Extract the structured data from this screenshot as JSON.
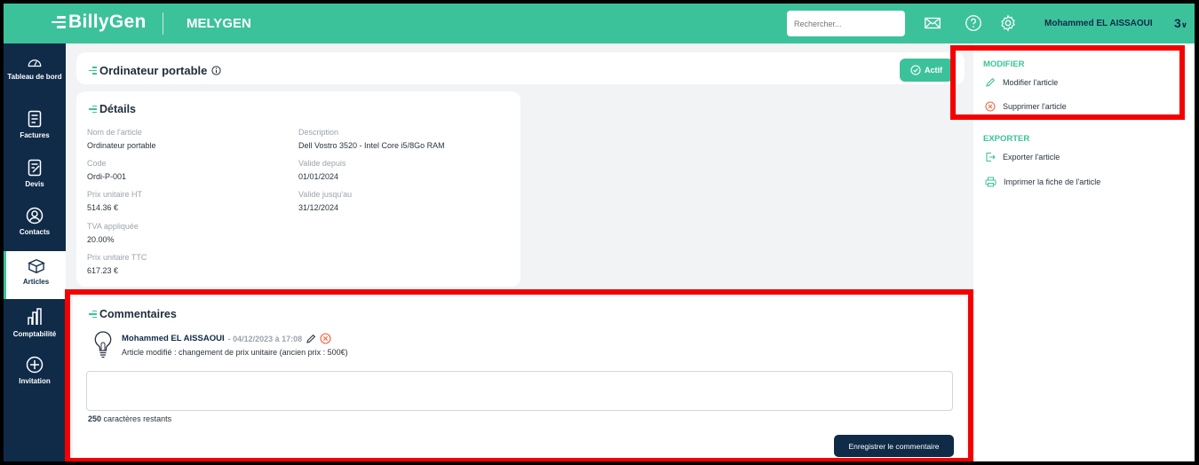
{
  "app": {
    "brand": "BillyGen",
    "company": "MELYGEN"
  },
  "topbar": {
    "search_placeholder": "Rechercher...",
    "user_name": "Mohammed EL AISSAOUI",
    "user_menu": "3"
  },
  "sidebar": {
    "items": [
      {
        "label": "Tableau de bord",
        "icon": "gauge-icon"
      },
      {
        "label": "Factures",
        "icon": "invoice-icon"
      },
      {
        "label": "Devis",
        "icon": "quote-icon"
      },
      {
        "label": "Contacts",
        "icon": "contacts-icon"
      },
      {
        "label": "Articles",
        "icon": "box-icon",
        "active": true
      },
      {
        "label": "Comptabilité",
        "icon": "accounting-icon"
      },
      {
        "label": "Invitation",
        "icon": "plus-circle-icon"
      }
    ]
  },
  "header": {
    "title": "Ordinateur portable",
    "status": "Actif"
  },
  "details": {
    "title": "Détails",
    "left": [
      {
        "label": "Nom de l'article",
        "value": "Ordinateur portable"
      },
      {
        "label": "Code",
        "value": "Ordi-P-001"
      },
      {
        "label": "Prix unitaire HT",
        "value": "514.36 €"
      },
      {
        "label": "TVA appliquée",
        "value": "20.00%"
      },
      {
        "label": "Prix unitaire TTC",
        "value": "617.23 €"
      }
    ],
    "right": [
      {
        "label": "Description",
        "value": "Dell Vostro 3520 - Intel Core i5/8Go RAM"
      },
      {
        "label": "Valide depuis",
        "value": "01/01/2024"
      },
      {
        "label": "Valide jusqu'au",
        "value": "31/12/2024"
      }
    ]
  },
  "comments": {
    "title": "Commentaires",
    "items": [
      {
        "author": "Mohammed EL AISSAOUI",
        "date": "- 04/12/2023 à 17:08",
        "text": "Article modifié : changement de prix unitaire (ancien prix : 500€)"
      }
    ],
    "chars_left_count": "250",
    "chars_left_label": "caractères restants",
    "save_label": "Enregistrer le commentaire"
  },
  "actions": {
    "modify_heading": "MODIFIER",
    "modify_item": "Modifier l'article",
    "delete_item": "Supprimer l'article",
    "export_heading": "EXPORTER",
    "export_item": "Exporter l'article",
    "print_item": "Imprimer la fiche de l'article"
  },
  "colors": {
    "accent": "#3cc29a",
    "navy": "#0f2b48",
    "danger": "#f26b4a",
    "highlight": "#f40000"
  }
}
